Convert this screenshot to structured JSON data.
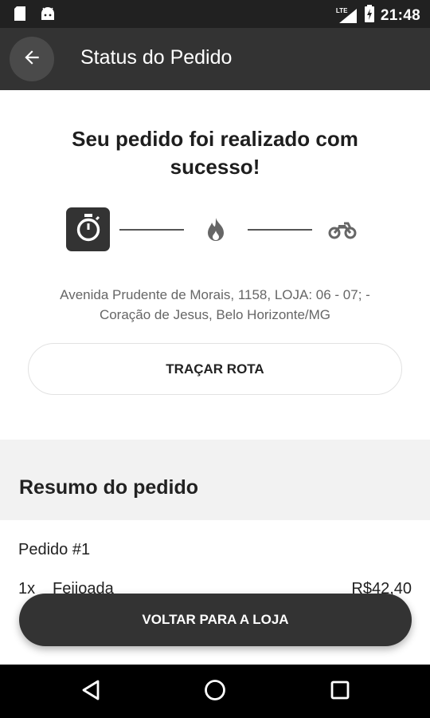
{
  "status_bar": {
    "time": "21:48",
    "network_label": "LTE",
    "left_icons": [
      "sd-card-icon",
      "android-icon"
    ],
    "right_icons": [
      "lte-signal-icon",
      "battery-charging-icon"
    ]
  },
  "app_bar": {
    "title": "Status do Pedido",
    "back_icon": "arrow-left-icon"
  },
  "order_status": {
    "message": "Seu pedido foi realizado com sucesso!",
    "steps": [
      {
        "icon": "stopwatch-icon",
        "active": true
      },
      {
        "icon": "fire-icon",
        "active": false
      },
      {
        "icon": "motorcycle-icon",
        "active": false
      }
    ]
  },
  "store": {
    "address_line1": "Avenida Prudente de Morais, 1158, LOJA: 06 - 07; -",
    "address_line2": "Coração de Jesus, Belo Horizonte/MG",
    "route_button": "TRAÇAR ROTA"
  },
  "summary": {
    "title": "Resumo do pedido",
    "order_label": "Pedido #1",
    "items": [
      {
        "qty": "1x",
        "name": "Feijoada",
        "price": "R$42,40"
      }
    ]
  },
  "footer": {
    "back_to_store": "VOLTAR PARA A LOJA"
  },
  "nav_bar": {
    "icons": [
      "back-triangle-icon",
      "home-circle-icon",
      "recents-square-icon"
    ]
  },
  "colors": {
    "status_bar": "#212121",
    "app_bar": "#333333",
    "accent_dark": "#333333",
    "summary_bg": "#f2f2f2",
    "address_text": "#666666"
  }
}
